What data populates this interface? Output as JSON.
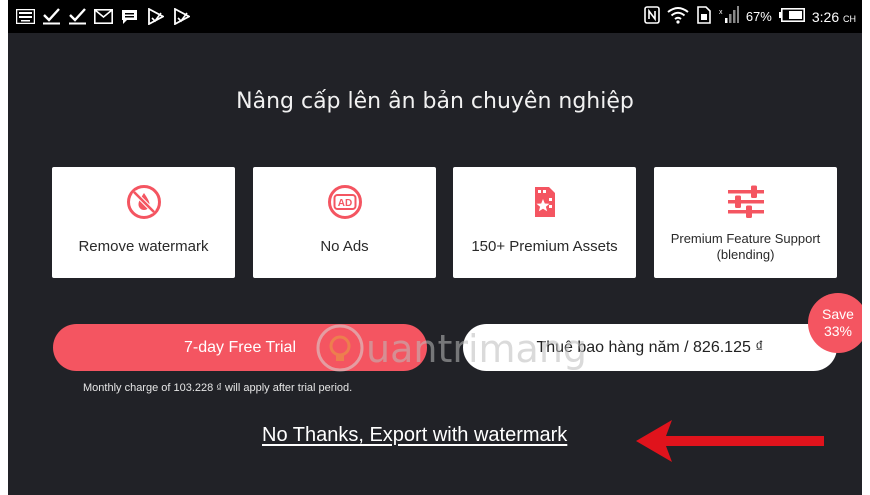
{
  "status_bar": {
    "battery_pct": "67%",
    "time": "3:26",
    "time_suffix": "CH"
  },
  "title": "Nâng cấp lên ân bản chuyên nghiệp",
  "features": [
    {
      "label": "Remove watermark",
      "icon": "no-drop-icon"
    },
    {
      "label": "No Ads",
      "icon": "no-ads-icon"
    },
    {
      "label": "150+ Premium Assets",
      "icon": "premium-assets-icon"
    },
    {
      "label": "Premium Feature Support (blending)",
      "icon": "sliders-icon"
    }
  ],
  "trial_button": "7-day Free Trial",
  "subscribe_button": "Thuê bao hàng năm / 826.125 ₫",
  "save_badge": {
    "line1": "Save",
    "line2": "33%"
  },
  "note": "Monthly charge of 103.228 ₫ will apply after trial period.",
  "no_thanks": "No Thanks, Export with watermark",
  "watermark_text": "uantrimang",
  "colors": {
    "accent": "#f45561",
    "background": "#212227",
    "arrow": "#e0131c"
  }
}
